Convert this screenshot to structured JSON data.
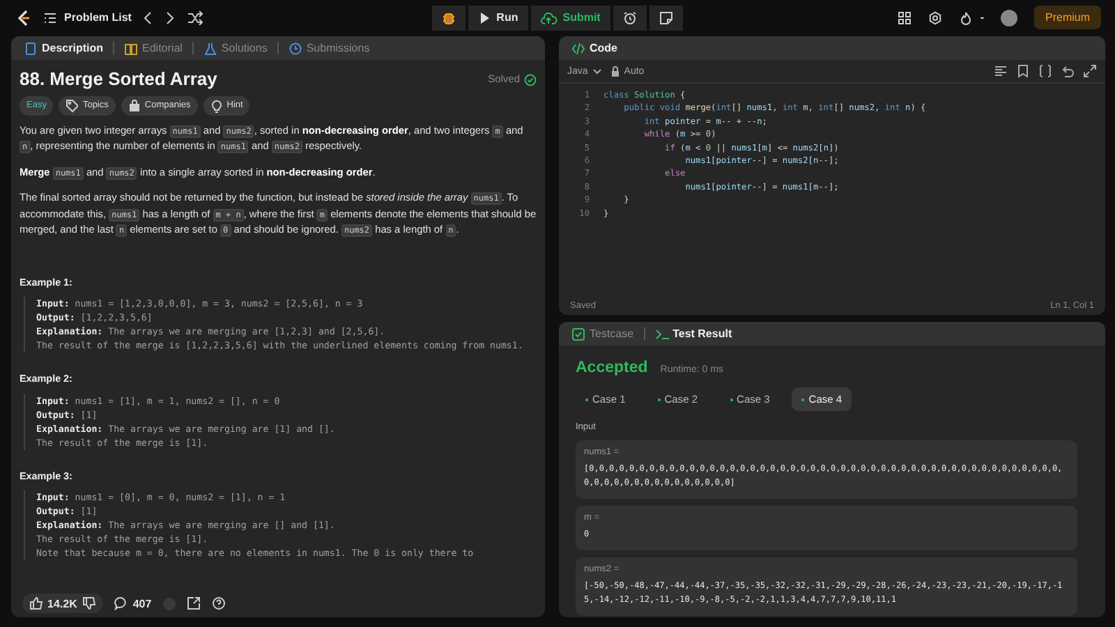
{
  "top_bar": {
    "problem_list": "Problem List",
    "run": "Run",
    "submit": "Submit",
    "streak": "-",
    "premium": "Premium"
  },
  "description_panel": {
    "tabs": [
      {
        "label": "Description",
        "selected": true,
        "kind": "description"
      },
      {
        "label": "Editorial",
        "selected": false,
        "kind": "editorial"
      },
      {
        "label": "Solutions",
        "selected": false,
        "kind": "solutions"
      },
      {
        "label": "Submissions",
        "selected": false,
        "kind": "submissions"
      }
    ],
    "title": "88. Merge Sorted Array",
    "status": "Solved",
    "tags": [
      {
        "label": "Easy",
        "kind": "difficulty"
      },
      {
        "label": "Topics",
        "kind": "topics"
      },
      {
        "label": "Companies",
        "kind": "companies"
      },
      {
        "label": "Hint",
        "kind": "hint"
      }
    ],
    "paragraphs": [
      [
        {
          "text": "You are given two integer arrays ",
          "kind": "text"
        },
        {
          "text": "nums1",
          "kind": "code"
        },
        {
          "text": " and ",
          "kind": "text"
        },
        {
          "text": "nums2",
          "kind": "code"
        },
        {
          "text": ", sorted in ",
          "kind": "text"
        },
        {
          "text": "non-decreasing order",
          "kind": "bold"
        },
        {
          "text": ", and two integers ",
          "kind": "text"
        },
        {
          "text": "m",
          "kind": "code"
        },
        {
          "text": " and ",
          "kind": "text"
        },
        {
          "text": "n",
          "kind": "code"
        },
        {
          "text": ", representing the number of elements in ",
          "kind": "text"
        },
        {
          "text": "nums1",
          "kind": "code"
        },
        {
          "text": " and ",
          "kind": "text"
        },
        {
          "text": "nums2",
          "kind": "code"
        },
        {
          "text": " respectively.",
          "kind": "text"
        }
      ],
      [
        {
          "text": "Merge ",
          "kind": "bold"
        },
        {
          "text": "nums1",
          "kind": "code"
        },
        {
          "text": " and ",
          "kind": "text"
        },
        {
          "text": "nums2",
          "kind": "code"
        },
        {
          "text": " into a single array sorted in ",
          "kind": "text"
        },
        {
          "text": "non-decreasing order",
          "kind": "bold"
        },
        {
          "text": ".",
          "kind": "text"
        }
      ],
      [
        {
          "text": "The final sorted array should not be returned by the function, but instead be ",
          "kind": "text"
        },
        {
          "text": "stored inside the array ",
          "kind": "italic"
        },
        {
          "text": "nums1",
          "kind": "code"
        },
        {
          "text": ". To accommodate this, ",
          "kind": "text"
        },
        {
          "text": "nums1",
          "kind": "code"
        },
        {
          "text": " has a length of ",
          "kind": "text"
        },
        {
          "text": "m + n",
          "kind": "code"
        },
        {
          "text": ", where the first ",
          "kind": "text"
        },
        {
          "text": "m",
          "kind": "code"
        },
        {
          "text": " elements denote the elements that should be merged, and the last ",
          "kind": "text"
        },
        {
          "text": "n",
          "kind": "code"
        },
        {
          "text": " elements are set to ",
          "kind": "text"
        },
        {
          "text": "0",
          "kind": "code"
        },
        {
          "text": " and should be ignored. ",
          "kind": "text"
        },
        {
          "text": "nums2",
          "kind": "code"
        },
        {
          "text": " has a length of ",
          "kind": "text"
        },
        {
          "text": "n",
          "kind": "code"
        },
        {
          "text": ".",
          "kind": "text"
        }
      ]
    ],
    "examples": [
      {
        "heading": "Example 1:",
        "lines": [
          "**Input:** nums1 = [1,2,3,0,0,0], m = 3, nums2 = [2,5,6], n = 3",
          "**Output:** [1,2,2,3,5,6]",
          "**Explanation:** The arrays we are merging are [1,2,3] and [2,5,6].",
          "The result of the merge is [1,2,2,3,5,6] with the underlined elements coming from nums1."
        ]
      },
      {
        "heading": "Example 2:",
        "lines": [
          "**Input:** nums1 = [1], m = 1, nums2 = [], n = 0",
          "**Output:** [1]",
          "**Explanation:** The arrays we are merging are [1] and [].",
          "The result of the merge is [1]."
        ]
      },
      {
        "heading": "Example 3:",
        "lines": [
          "**Input:** nums1 = [0], m = 0, nums2 = [1], n = 1",
          "**Output:** [1]",
          "**Explanation:** The arrays we are merging are [] and [1].",
          "The result of the merge is [1].",
          "Note that because m = 0, there are no elements in nums1. The 0 is only there to"
        ]
      }
    ],
    "footer": {
      "likes": "14.2K",
      "comments": "407"
    }
  },
  "code_panel": {
    "title": "Code",
    "language": "Java",
    "mode": "Auto",
    "lines": [
      {
        "number": "1",
        "tokens": [
          {
            "text": "class ",
            "kind": "kw"
          },
          {
            "text": "Solution",
            "kind": "cls"
          },
          {
            "text": " {",
            "kind": "p"
          }
        ]
      },
      {
        "number": "2",
        "tokens": [
          {
            "text": "    public void ",
            "kind": "kw"
          },
          {
            "text": "merge",
            "kind": "fn"
          },
          {
            "text": "(",
            "kind": "p"
          },
          {
            "text": "int",
            "kind": "kw"
          },
          {
            "text": "[] ",
            "kind": "p"
          },
          {
            "text": "nums1",
            "kind": "var"
          },
          {
            "text": ", ",
            "kind": "p"
          },
          {
            "text": "int ",
            "kind": "kw"
          },
          {
            "text": "m",
            "kind": "var"
          },
          {
            "text": ", ",
            "kind": "p"
          },
          {
            "text": "int",
            "kind": "kw"
          },
          {
            "text": "[] ",
            "kind": "p"
          },
          {
            "text": "nums2",
            "kind": "var"
          },
          {
            "text": ", ",
            "kind": "p"
          },
          {
            "text": "int ",
            "kind": "kw"
          },
          {
            "text": "n",
            "kind": "var"
          },
          {
            "text": ") {",
            "kind": "p"
          }
        ]
      },
      {
        "number": "3",
        "tokens": [
          {
            "text": "        int ",
            "kind": "kw"
          },
          {
            "text": "pointer",
            "kind": "var"
          },
          {
            "text": " = ",
            "kind": "p"
          },
          {
            "text": "m",
            "kind": "var"
          },
          {
            "text": "-- + --",
            "kind": "p"
          },
          {
            "text": "n",
            "kind": "var"
          },
          {
            "text": ";",
            "kind": "p"
          }
        ]
      },
      {
        "number": "4",
        "tokens": [
          {
            "text": "        while",
            "kind": "ctl"
          },
          {
            "text": " (",
            "kind": "p"
          },
          {
            "text": "m",
            "kind": "var"
          },
          {
            "text": " >= ",
            "kind": "p"
          },
          {
            "text": "0",
            "kind": "num"
          },
          {
            "text": ")",
            "kind": "p"
          }
        ]
      },
      {
        "number": "5",
        "tokens": [
          {
            "text": "            if",
            "kind": "ctl"
          },
          {
            "text": " (",
            "kind": "p"
          },
          {
            "text": "m",
            "kind": "var"
          },
          {
            "text": " < ",
            "kind": "p"
          },
          {
            "text": "0",
            "kind": "num"
          },
          {
            "text": " || ",
            "kind": "p"
          },
          {
            "text": "nums1",
            "kind": "var"
          },
          {
            "text": "[",
            "kind": "p"
          },
          {
            "text": "m",
            "kind": "var"
          },
          {
            "text": "] <= ",
            "kind": "p"
          },
          {
            "text": "nums2",
            "kind": "var"
          },
          {
            "text": "[",
            "kind": "p"
          },
          {
            "text": "n",
            "kind": "var"
          },
          {
            "text": "])",
            "kind": "p"
          }
        ]
      },
      {
        "number": "6",
        "tokens": [
          {
            "text": "                nums1",
            "kind": "var"
          },
          {
            "text": "[",
            "kind": "p"
          },
          {
            "text": "pointer",
            "kind": "var"
          },
          {
            "text": "--] = ",
            "kind": "p"
          },
          {
            "text": "nums2",
            "kind": "var"
          },
          {
            "text": "[",
            "kind": "p"
          },
          {
            "text": "n",
            "kind": "var"
          },
          {
            "text": "--];",
            "kind": "p"
          }
        ]
      },
      {
        "number": "7",
        "tokens": [
          {
            "text": "            else",
            "kind": "ctl"
          }
        ]
      },
      {
        "number": "8",
        "tokens": [
          {
            "text": "                nums1",
            "kind": "var"
          },
          {
            "text": "[",
            "kind": "p"
          },
          {
            "text": "pointer",
            "kind": "var"
          },
          {
            "text": "--] = ",
            "kind": "p"
          },
          {
            "text": "nums1",
            "kind": "var"
          },
          {
            "text": "[",
            "kind": "p"
          },
          {
            "text": "m",
            "kind": "var"
          },
          {
            "text": "--];",
            "kind": "p"
          }
        ]
      },
      {
        "number": "9",
        "tokens": [
          {
            "text": "    }",
            "kind": "p"
          }
        ]
      },
      {
        "number": "10",
        "tokens": [
          {
            "text": "}",
            "kind": "p"
          }
        ]
      }
    ],
    "status": "Saved",
    "cursor": "Ln 1, Col 1"
  },
  "test_panel": {
    "tabs": [
      {
        "label": "Testcase",
        "selected": false,
        "kind": "testcase"
      },
      {
        "label": "Test Result",
        "selected": true,
        "kind": "result"
      }
    ],
    "verdict": "Accepted",
    "runtime": "Runtime: 0 ms",
    "cases": [
      {
        "label": "Case 1",
        "selected": false
      },
      {
        "label": "Case 2",
        "selected": false
      },
      {
        "label": "Case 3",
        "selected": false
      },
      {
        "label": "Case 4",
        "selected": true
      }
    ],
    "input_label": "Input",
    "inputs": [
      {
        "name": "nums1 =",
        "value": "[0,0,0,0,0,0,0,0,0,0,0,0,0,0,0,0,0,0,0,0,0,0,0,0,0,0,0,0,0,0,0,0,0,0,0,0,0,0,0,0,0,0,0,0,0,0,0,0,0,0,0,0,0,0,0,0,0,0,0,0,0,0]"
      },
      {
        "name": "m =",
        "value": "0"
      },
      {
        "name": "nums2 =",
        "value": "[-50,-50,-48,-47,-44,-44,-37,-35,-35,-32,-32,-31,-29,-29,-28,-26,-24,-23,-23,-21,-20,-19,-17,-15,-14,-12,-12,-11,-10,-9,-8,-5,-2,-2,1,1,3,4,4,7,7,7,9,10,11,1"
      }
    ]
  }
}
